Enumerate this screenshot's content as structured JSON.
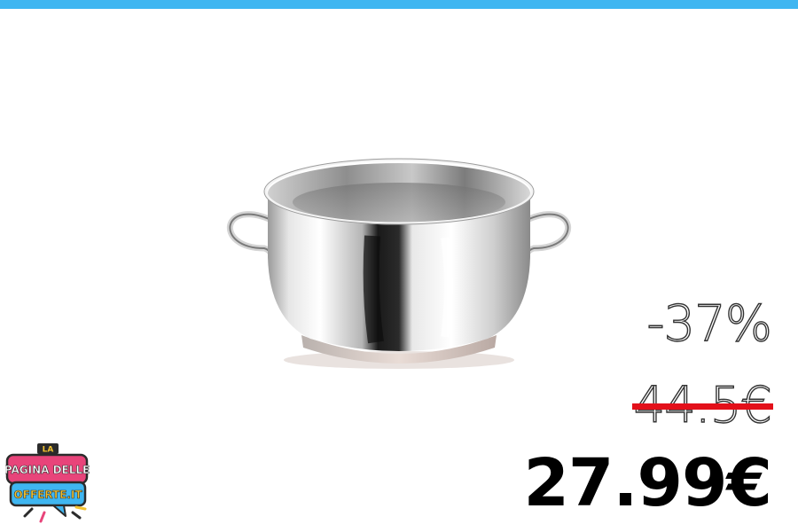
{
  "colors": {
    "accent_bar": "#3fb6f1",
    "strike": "#e3101a",
    "price": "#000000"
  },
  "pricing": {
    "discount": "-37%",
    "old_price": "44.5€",
    "new_price": "27.99€"
  },
  "logo": {
    "line1": "LA",
    "line2": "PAGINA DELLE",
    "line3": "OFFERTE.IT"
  },
  "icons": {
    "product": "stainless-steel-casserole-pot"
  }
}
